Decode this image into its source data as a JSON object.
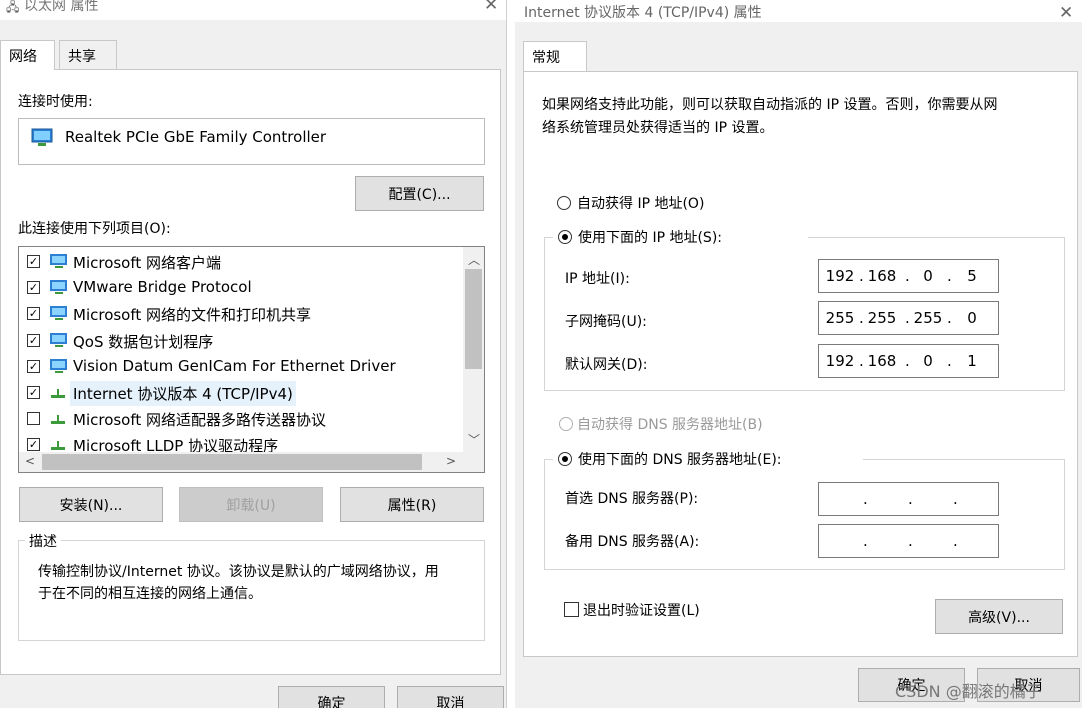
{
  "left_dialog": {
    "title": "以太网 属性",
    "tabs": [
      "网络",
      "共享"
    ],
    "connect_using_label": "连接时使用:",
    "adapter_name": "Realtek PCIe GbE Family Controller",
    "configure_button": "配置(C)...",
    "items_label": "此连接使用下列项目(O):",
    "items": [
      {
        "label": "Microsoft 网络客户端",
        "checked": true,
        "icon": "network-client-icon"
      },
      {
        "label": "VMware Bridge Protocol",
        "checked": true,
        "icon": "network-service-icon"
      },
      {
        "label": "Microsoft 网络的文件和打印机共享",
        "checked": true,
        "icon": "network-service-icon"
      },
      {
        "label": "QoS 数据包计划程序",
        "checked": true,
        "icon": "network-service-icon"
      },
      {
        "label": "Vision Datum GenICam For Ethernet Driver",
        "checked": true,
        "icon": "network-service-icon"
      },
      {
        "label": "Internet 协议版本 4 (TCP/IPv4)",
        "checked": true,
        "icon": "protocol-icon"
      },
      {
        "label": "Microsoft 网络适配器多路传送器协议",
        "checked": false,
        "icon": "protocol-icon"
      },
      {
        "label": "Microsoft LLDP 协议驱动程序",
        "checked": true,
        "icon": "protocol-icon"
      }
    ],
    "install_button": "安装(N)...",
    "uninstall_button": "卸载(U)",
    "properties_button": "属性(R)",
    "description_title": "描述",
    "description_text_line1": "传输控制协议/Internet 协议。该协议是默认的广域网络协议，用",
    "description_text_line2": "于在不同的相互连接的网络上通信。",
    "ok_button": "确定",
    "cancel_button": "取消"
  },
  "right_dialog": {
    "title": "Internet 协议版本 4 (TCP/IPv4) 属性",
    "tab": "常规",
    "intro_line1": "如果网络支持此功能，则可以获取自动指派的 IP 设置。否则，你需要从网",
    "intro_line2": "络系统管理员处获得适当的 IP 设置。",
    "auto_ip_label": "自动获得 IP 地址(O)",
    "manual_ip_label": "使用下面的 IP 地址(S):",
    "ip_address_label": "IP 地址(I):",
    "ip_address": [
      "192",
      "168",
      "0",
      "5"
    ],
    "subnet_mask_label": "子网掩码(U):",
    "subnet_mask": [
      "255",
      "255",
      "255",
      "0"
    ],
    "gateway_label": "默认网关(D):",
    "gateway": [
      "192",
      "168",
      "0",
      "1"
    ],
    "auto_dns_label": "自动获得 DNS 服务器地址(B)",
    "manual_dns_label": "使用下面的 DNS 服务器地址(E):",
    "preferred_dns_label": "首选 DNS 服务器(P):",
    "preferred_dns": [
      "",
      "",
      "",
      ""
    ],
    "alternate_dns_label": "备用 DNS 服务器(A):",
    "alternate_dns": [
      "",
      "",
      "",
      ""
    ],
    "validate_on_exit_label": "退出时验证设置(L)",
    "advanced_button": "高级(V)...",
    "ok_button": "确定",
    "cancel_button": "取消"
  },
  "watermark": "CSDN @翻滚的橘子"
}
